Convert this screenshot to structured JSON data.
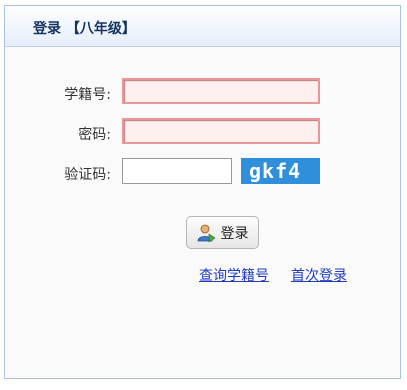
{
  "panel": {
    "title": "登录 【八年级】"
  },
  "form": {
    "student_id_label": "学籍号:",
    "password_label": "密码:",
    "captcha_label": "验证码:",
    "student_id_value": "",
    "password_value": "",
    "captcha_value": "",
    "captcha_text": "gkf4"
  },
  "actions": {
    "login_label": "登录",
    "query_link": "查询学籍号",
    "first_login_link": "首次登录"
  },
  "icons": {
    "login": "user-login-icon"
  },
  "colors": {
    "captcha_bg": "#2f8fda",
    "link": "#1e3cc2",
    "error_border": "#e89898"
  }
}
